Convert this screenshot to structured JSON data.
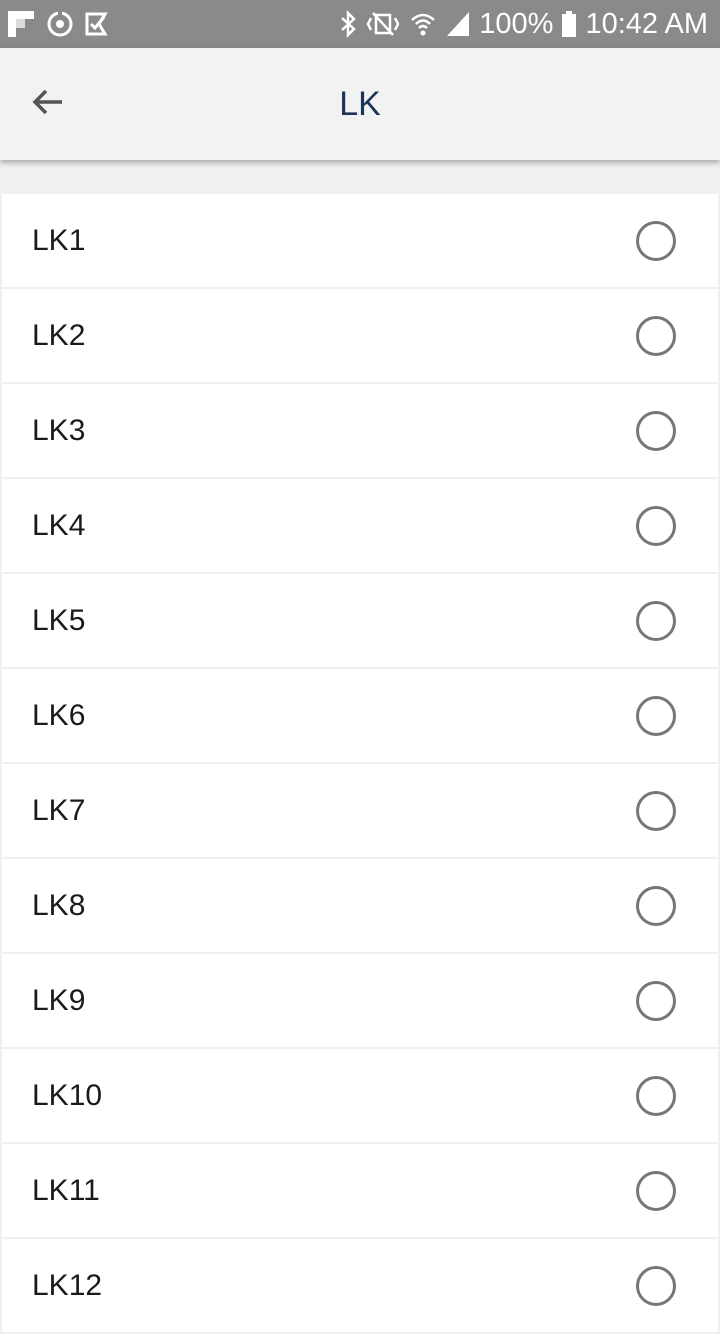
{
  "status_bar": {
    "battery_text": "100%",
    "clock_text": "10:42 AM",
    "left_icons": [
      "flipboard-icon",
      "sync-icon",
      "task-icon"
    ],
    "right_icons": [
      "bluetooth-icon",
      "vibrate-icon",
      "wifi-icon",
      "signal-icon",
      "battery-icon"
    ]
  },
  "app_bar": {
    "title": "LK",
    "back_icon": "arrow-left-icon"
  },
  "list": {
    "items": [
      {
        "label": "LK1",
        "selected": false
      },
      {
        "label": "LK2",
        "selected": false
      },
      {
        "label": "LK3",
        "selected": false
      },
      {
        "label": "LK4",
        "selected": false
      },
      {
        "label": "LK5",
        "selected": false
      },
      {
        "label": "LK6",
        "selected": false
      },
      {
        "label": "LK7",
        "selected": false
      },
      {
        "label": "LK8",
        "selected": false
      },
      {
        "label": "LK9",
        "selected": false
      },
      {
        "label": "LK10",
        "selected": false
      },
      {
        "label": "LK11",
        "selected": false
      },
      {
        "label": "LK12",
        "selected": false
      }
    ]
  }
}
